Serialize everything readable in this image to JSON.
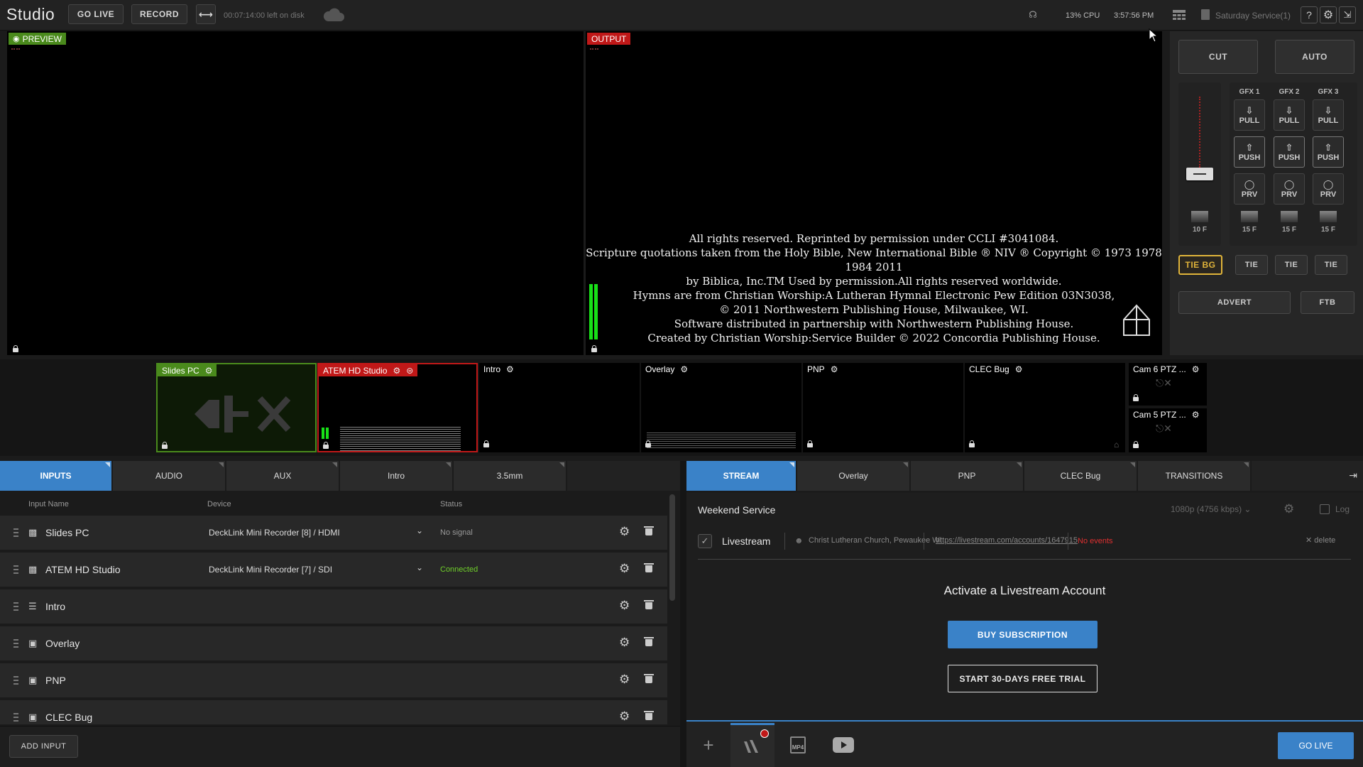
{
  "app": {
    "title": "Studio"
  },
  "topbar": {
    "go_live": "GO LIVE",
    "record": "RECORD",
    "disk": "00:07:14:00 left on disk",
    "cpu": "13% CPU",
    "clock": "3:57:56 PM",
    "project": "Saturday Service(1)"
  },
  "preview": {
    "label": "PREVIEW"
  },
  "output": {
    "label": "OUTPUT",
    "lines": [
      "All rights reserved. Reprinted by permission under CCLI #3041084.",
      "Scripture quotations taken from the Holy Bible, New International Bible ® NIV ® Copyright © 1973 1978 1984 2011",
      "by Biblica, Inc.TM  Used by permission.All rights reserved worldwide.",
      "Hymns are from Christian Worship:A Lutheran Hymnal Electronic Pew Edition 03N3038,",
      "© 2011 Northwestern Publishing House, Milwaukee, WI.",
      "Software distributed in partnership with Northwestern Publishing House.",
      "Created by Christian Worship:Service Builder © 2022 Concordia Publishing House."
    ]
  },
  "controls": {
    "cut": "CUT",
    "auto": "AUTO",
    "gfx": [
      {
        "name": "GFX 1",
        "pull": "PULL",
        "push": "PUSH",
        "prv": "PRV",
        "frames": "15 F",
        "tie": "TIE"
      },
      {
        "name": "GFX 2",
        "pull": "PULL",
        "push": "PUSH",
        "prv": "PRV",
        "frames": "15 F",
        "tie": "TIE"
      },
      {
        "name": "GFX 3",
        "pull": "PULL",
        "push": "PUSH",
        "prv": "PRV",
        "frames": "15 F",
        "tie": "TIE"
      }
    ],
    "main_frames": "10 F",
    "tie_bg": "TIE BG",
    "advert": "ADVERT",
    "ftb": "FTB",
    "tbar_position": 0.0
  },
  "thumbs": [
    {
      "name": "Slides PC",
      "color": "#4a8a1c"
    },
    {
      "name": "ATEM HD Studio",
      "color": "#c01818"
    },
    {
      "name": "Intro"
    },
    {
      "name": "Overlay"
    },
    {
      "name": "PNP"
    },
    {
      "name": "CLEC Bug"
    },
    {
      "name": "Cam 6 PTZ ..."
    },
    {
      "name": "Cam 5 PTZ ..."
    }
  ],
  "left_tabs": [
    "INPUTS",
    "AUDIO",
    "AUX",
    "Intro",
    "3.5mm"
  ],
  "table": {
    "headers": {
      "name": "Input Name",
      "device": "Device",
      "status": "Status"
    },
    "rows": [
      {
        "name": "Slides PC",
        "icon": "camera-icon",
        "device": "DeckLink Mini Recorder [8] / HDMI",
        "status": "No signal"
      },
      {
        "name": "ATEM HD Studio",
        "icon": "camera-icon",
        "device": "DeckLink Mini Recorder [7] / SDI",
        "status": "Connected"
      },
      {
        "name": "Intro",
        "icon": "playlist-icon",
        "device": "",
        "status": ""
      },
      {
        "name": "Overlay",
        "icon": "image-icon",
        "device": "",
        "status": ""
      },
      {
        "name": "PNP",
        "icon": "image-icon",
        "device": "",
        "status": ""
      },
      {
        "name": "CLEC Bug",
        "icon": "image-icon",
        "device": "",
        "status": ""
      }
    ]
  },
  "add_input": "ADD INPUT",
  "right_tabs": [
    "STREAM",
    "Overlay",
    "PNP",
    "CLEC Bug",
    "TRANSITIONS"
  ],
  "stream": {
    "title": "Weekend Service",
    "quality": "1080p (4756 kbps)",
    "log": "Log",
    "service": "Livestream",
    "account": "Christ Lutheran Church, Pewaukee WI",
    "url": "https://livestream.com/accounts/1647915",
    "events": "No events",
    "delete": "delete",
    "activate": "Activate a Livestream Account",
    "buy": "BUY SUBSCRIPTION",
    "trial": "START 30-DAYS FREE TRIAL"
  },
  "footer": {
    "go_live": "GO LIVE",
    "mp4": "MP4"
  },
  "colors": {
    "accent": "#3a82c8",
    "preview": "#4a8a1c",
    "program": "#c01818",
    "tie_bg": "#e0b43a"
  }
}
